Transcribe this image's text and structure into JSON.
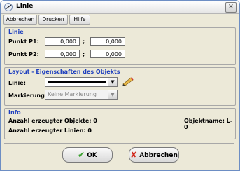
{
  "window": {
    "title": "Linie",
    "close_glyph": "×"
  },
  "toolbar": {
    "items": [
      "Abbrechen",
      "Drucken",
      "Hilfe"
    ]
  },
  "group_linie": {
    "title": "Linie",
    "p1_label": "Punkt P1:",
    "p1_x": "0,000",
    "p1_y": "0,000",
    "p2_label": "Punkt P2:",
    "p2_x": "0,000",
    "p2_y": "0,000",
    "separator": ";"
  },
  "group_layout": {
    "title": "Layout - Eigenschaften des Objekts",
    "linie_label": "Linie:",
    "markierung_label": "Markierung:",
    "markierung_value": "Keine Markierung"
  },
  "group_info": {
    "title": "Info",
    "objekte": "Anzahl erzeugter Objekte: 0",
    "linien": "Anzahl erzeugter Linien: 0",
    "objektname": "Objektname: L-0"
  },
  "buttons": {
    "ok": "OK",
    "abbrechen": "Abbrechen"
  },
  "colors": {
    "group_title": "#1e3fbf",
    "ok_check": "#3aa12f",
    "cancel_x": "#d22b1f"
  }
}
